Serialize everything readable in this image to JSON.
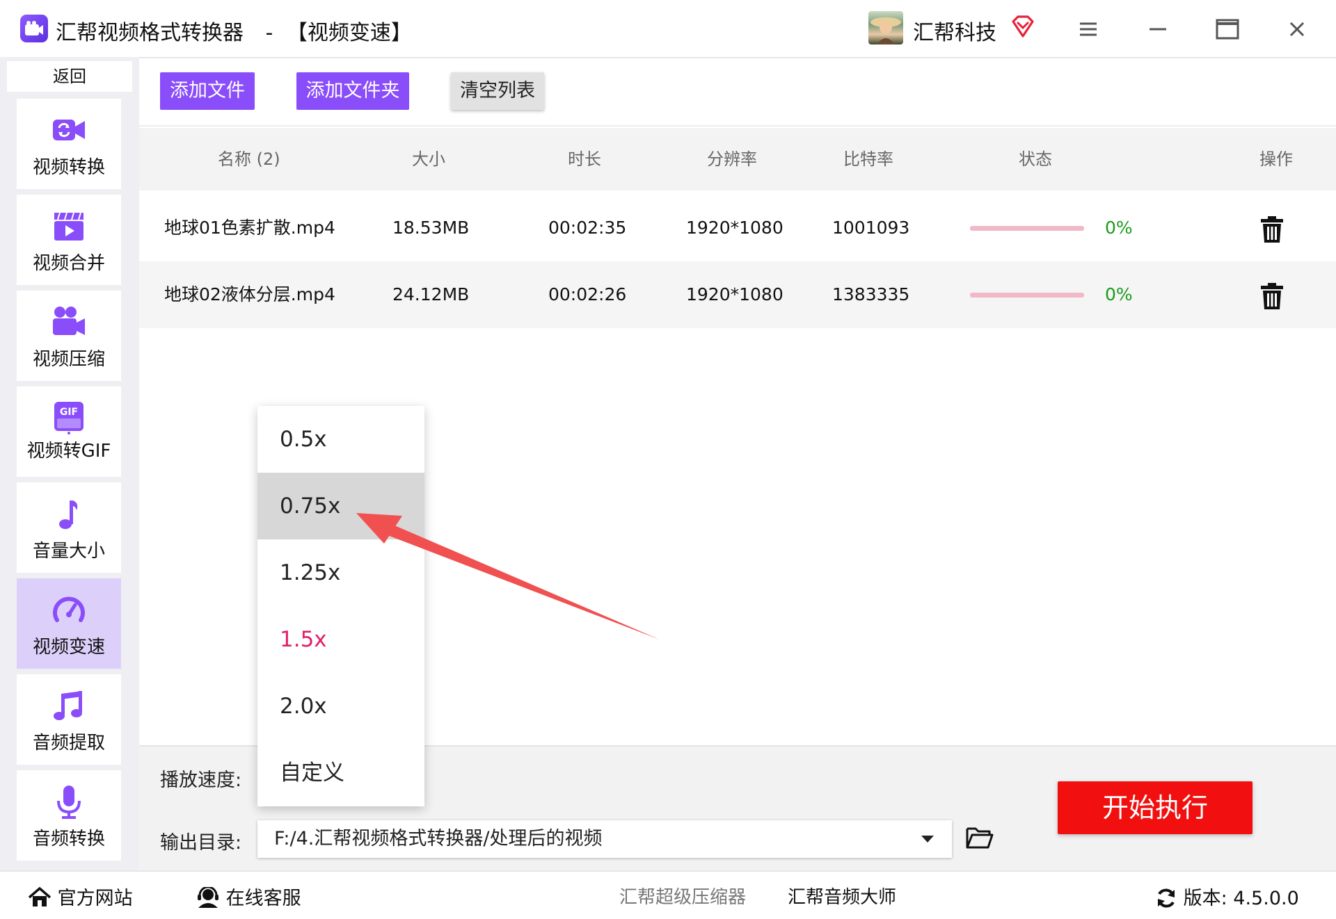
{
  "app": {
    "title": "汇帮视频格式转换器",
    "separator": "-",
    "mode": "【视频变速】",
    "user_name": "汇帮科技"
  },
  "sidebar": {
    "back_label": "返回",
    "items": [
      {
        "label": "视频转换",
        "icon": "video-convert-icon"
      },
      {
        "label": "视频合并",
        "icon": "video-merge-icon"
      },
      {
        "label": "视频压缩",
        "icon": "video-compress-icon"
      },
      {
        "label": "视频转GIF",
        "icon": "gif-icon",
        "icon_text": "GIF"
      },
      {
        "label": "音量大小",
        "icon": "music-note-icon"
      },
      {
        "label": "视频变速",
        "icon": "speedometer-icon",
        "active": true
      },
      {
        "label": "音频提取",
        "icon": "music-notes-icon"
      },
      {
        "label": "音频转换",
        "icon": "microphone-icon"
      }
    ]
  },
  "toolbar": {
    "add_file": "添加文件",
    "add_folder": "添加文件夹",
    "clear_list": "清空列表"
  },
  "table": {
    "headers": [
      "名称 (2)",
      "大小",
      "时长",
      "分辨率",
      "比特率",
      "状态",
      "操作"
    ],
    "rows": [
      {
        "name": "地球01色素扩散.mp4",
        "size": "18.53MB",
        "duration": "00:02:35",
        "resolution": "1920*1080",
        "bitrate": "1001093",
        "progress": 0,
        "progress_text": "0%"
      },
      {
        "name": "地球02液体分层.mp4",
        "size": "24.12MB",
        "duration": "00:02:26",
        "resolution": "1920*1080",
        "bitrate": "1383335",
        "progress": 0,
        "progress_text": "0%"
      }
    ]
  },
  "settings": {
    "speed_label": "播放速度:",
    "output_label": "输出目录:",
    "output_path": "F:/4.汇帮视频格式转换器/处理后的视频",
    "start_button": "开始执行"
  },
  "speed_dropdown": {
    "options": [
      "0.5x",
      "0.75x",
      "1.25x",
      "1.5x",
      "2.0x",
      "自定义"
    ],
    "hovered": "0.75x",
    "selected": "1.5x"
  },
  "footer": {
    "website": "官方网站",
    "support": "在线客服",
    "link_compressor": "汇帮超级压缩器",
    "link_audio": "汇帮音频大师",
    "version_label": "版本:",
    "version": "4.5.0.0"
  },
  "colors": {
    "accent": "#8a4dfa",
    "start_button": "#f20f0f",
    "selected_option": "#e0206a",
    "progress_text": "#1a9a1a",
    "annotation_arrow": "#f05050"
  }
}
